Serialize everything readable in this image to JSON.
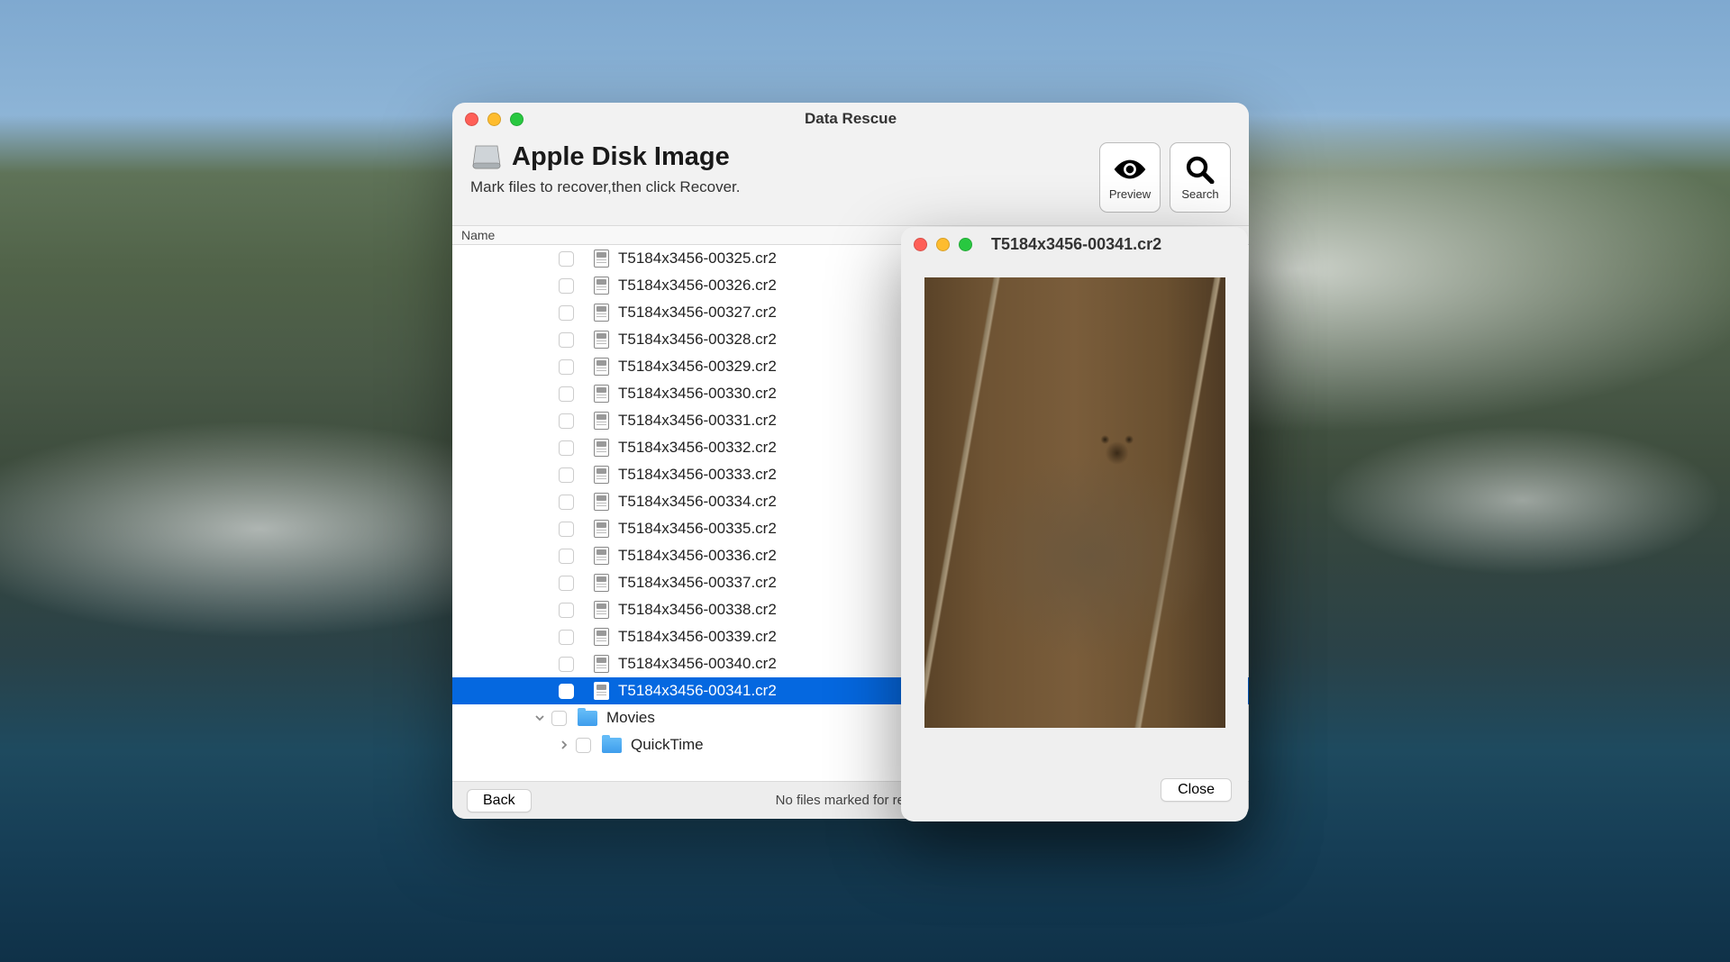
{
  "main_window": {
    "title": "Data Rescue",
    "header_title": "Apple Disk Image",
    "header_subtitle": "Mark files to recover,then click Recover.",
    "toolbar": {
      "preview_label": "Preview",
      "search_label": "Search"
    },
    "column_header": "Name",
    "files": [
      {
        "name": "T5184x3456-00325.cr2",
        "selected": false
      },
      {
        "name": "T5184x3456-00326.cr2",
        "selected": false
      },
      {
        "name": "T5184x3456-00327.cr2",
        "selected": false
      },
      {
        "name": "T5184x3456-00328.cr2",
        "selected": false
      },
      {
        "name": "T5184x3456-00329.cr2",
        "selected": false
      },
      {
        "name": "T5184x3456-00330.cr2",
        "selected": false
      },
      {
        "name": "T5184x3456-00331.cr2",
        "selected": false
      },
      {
        "name": "T5184x3456-00332.cr2",
        "selected": false
      },
      {
        "name": "T5184x3456-00333.cr2",
        "selected": false
      },
      {
        "name": "T5184x3456-00334.cr2",
        "selected": false
      },
      {
        "name": "T5184x3456-00335.cr2",
        "selected": false
      },
      {
        "name": "T5184x3456-00336.cr2",
        "selected": false
      },
      {
        "name": "T5184x3456-00337.cr2",
        "selected": false
      },
      {
        "name": "T5184x3456-00338.cr2",
        "selected": false
      },
      {
        "name": "T5184x3456-00339.cr2",
        "selected": false
      },
      {
        "name": "T5184x3456-00340.cr2",
        "selected": false
      },
      {
        "name": "T5184x3456-00341.cr2",
        "selected": true
      }
    ],
    "folders": [
      {
        "name": "Movies",
        "indent": 0,
        "expanded": true
      },
      {
        "name": "QuickTime",
        "indent": 1,
        "expanded": false
      }
    ],
    "back_label": "Back",
    "status_text": "No files marked for recov"
  },
  "preview_window": {
    "title": "T5184x3456-00341.cr2",
    "close_label": "Close"
  }
}
